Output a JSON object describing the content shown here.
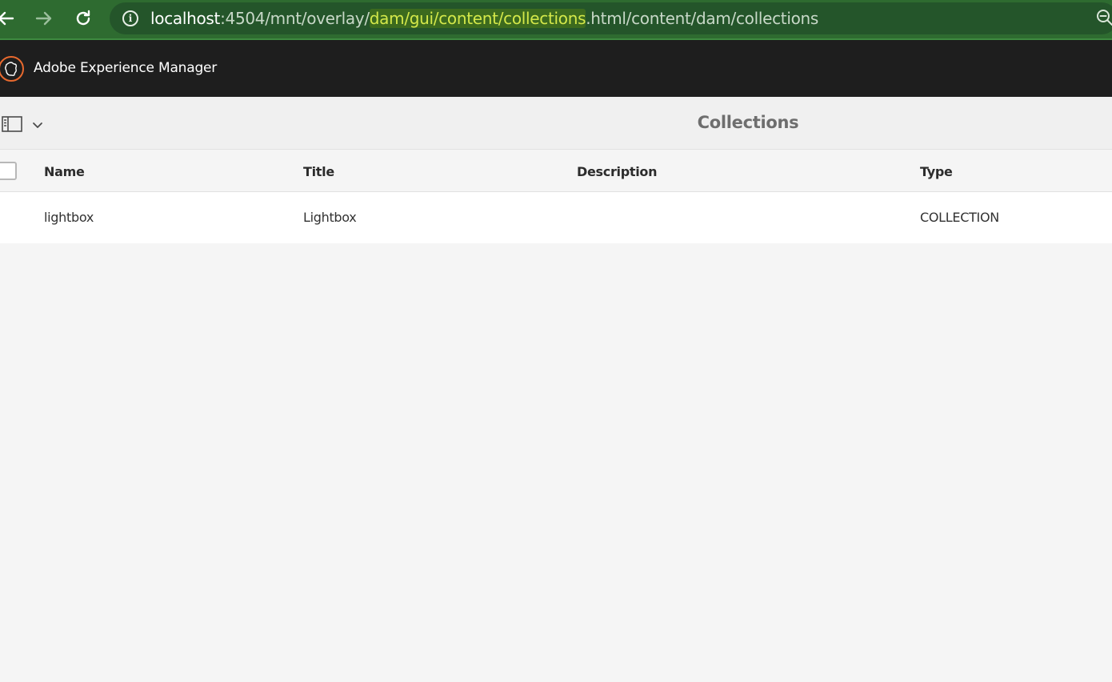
{
  "browser": {
    "url_host": "localhost",
    "url_prefix": ":4504/mnt/overlay/",
    "url_highlight": "dam/gui/content/collections",
    "url_suffix": ".html/content/dam/collections"
  },
  "app": {
    "title": "Adobe Experience Manager"
  },
  "page": {
    "title": "Collections"
  },
  "table": {
    "columns": [
      "Name",
      "Title",
      "Description",
      "Type"
    ],
    "rows": [
      {
        "name": "lightbox",
        "title": "Lightbox",
        "description": "",
        "type": "COLLECTION"
      }
    ]
  },
  "colors": {
    "browser_bar": "#2e6b30",
    "header_bg": "#1e1e1e",
    "logo_accent": "#e8692e",
    "page_bg": "#f5f5f5"
  }
}
